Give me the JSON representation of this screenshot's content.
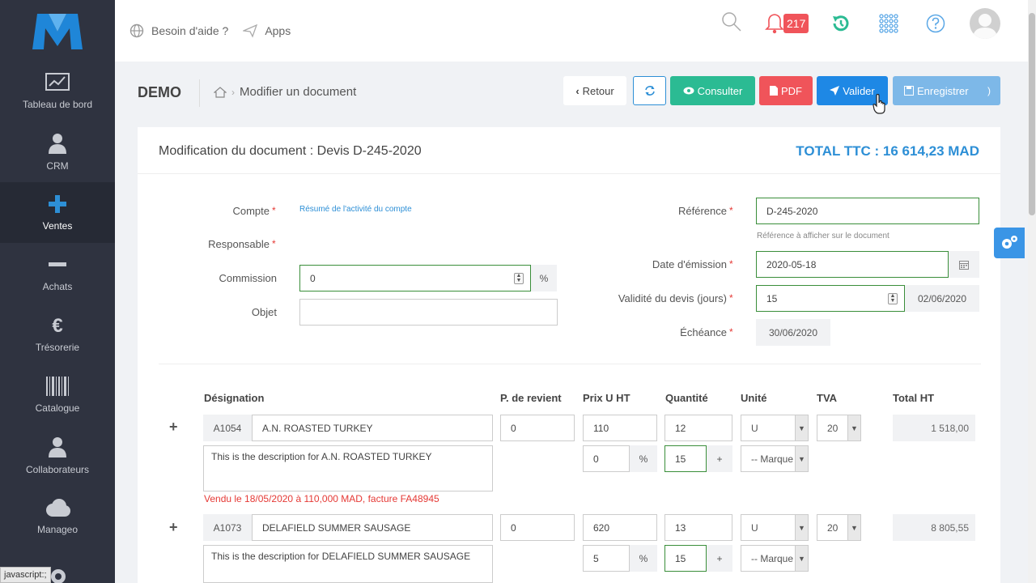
{
  "sidebar": {
    "items": [
      {
        "label": "Tableau de bord",
        "icon": "chart-icon"
      },
      {
        "label": "CRM",
        "icon": "user-icon"
      },
      {
        "label": "Ventes",
        "icon": "plus-icon"
      },
      {
        "label": "Achats",
        "icon": "minus-icon"
      },
      {
        "label": "Trésorerie",
        "icon": "euro-icon"
      },
      {
        "label": "Catalogue",
        "icon": "barcode-icon"
      },
      {
        "label": "Collaborateurs",
        "icon": "user-icon"
      },
      {
        "label": "Manageo",
        "icon": "cloud-icon"
      }
    ],
    "status_text": "javascript:;"
  },
  "topbar": {
    "help_label": "Besoin d'aide ?",
    "apps_label": "Apps",
    "notification_count": "217"
  },
  "header": {
    "company": "DEMO",
    "breadcrumb": "Modifier un document",
    "buttons": {
      "retour": "Retour",
      "consulter": "Consulter",
      "pdf": "PDF",
      "valider": "Valider",
      "enregistrer": "Enregistrer"
    }
  },
  "document": {
    "title": "Modification du document : Devis D-245-2020",
    "total": "TOTAL TTC : 16 614,23 MAD",
    "labels": {
      "compte": "Compte",
      "responsable": "Responsable",
      "commission": "Commission",
      "objet": "Objet",
      "reference": "Référence",
      "date_emission": "Date d'émission",
      "validite": "Validité du devis (jours)",
      "echeance": "Échéance"
    },
    "required_mark": "*",
    "compte_link": "Résumé de l'activité du compte",
    "commission_value": "0",
    "percent": "%",
    "objet_value": "",
    "reference_value": "D-245-2020",
    "reference_help": "Référence à afficher sur le document",
    "date_emission_value": "2020-05-18",
    "validite_value": "15",
    "validite_date": "02/06/2020",
    "echeance_value": "30/06/2020"
  },
  "table": {
    "headers": [
      "Désignation",
      "P. de revient",
      "Prix U HT",
      "Quantité",
      "Unité",
      "TVA",
      "Total HT"
    ],
    "plus_sign": "+",
    "rows": [
      {
        "code": "A1054",
        "name": "A.N. ROASTED TURKEY",
        "cost": "0",
        "price": "110",
        "qty": "12",
        "unit": "U",
        "tva": "20",
        "total": "1 518,00",
        "description": "This is the description for A.N. ROASTED TURKEY",
        "discount": "0",
        "discount_unit": "%",
        "margin": "15",
        "marque": "-- Marque",
        "warning": "Vendu le 18/05/2020 à 110,000 MAD, facture FA48945"
      },
      {
        "code": "A1073",
        "name": "DELAFIELD SUMMER SAUSAGE",
        "cost": "0",
        "price": "620",
        "qty": "13",
        "unit": "U",
        "tva": "20",
        "total": "8 805,55",
        "description": "This is the description for DELAFIELD SUMMER SAUSAGE",
        "discount": "5",
        "discount_unit": "%",
        "margin": "15",
        "marque": "-- Marque",
        "warning": ""
      }
    ]
  },
  "colors": {
    "sidebar": "#2f3340",
    "accent": "#2d8fd6",
    "consulter": "#2bbb93",
    "pdf": "#f0545a",
    "valider": "#1e88e5",
    "enregistrer": "#7db8e8"
  }
}
